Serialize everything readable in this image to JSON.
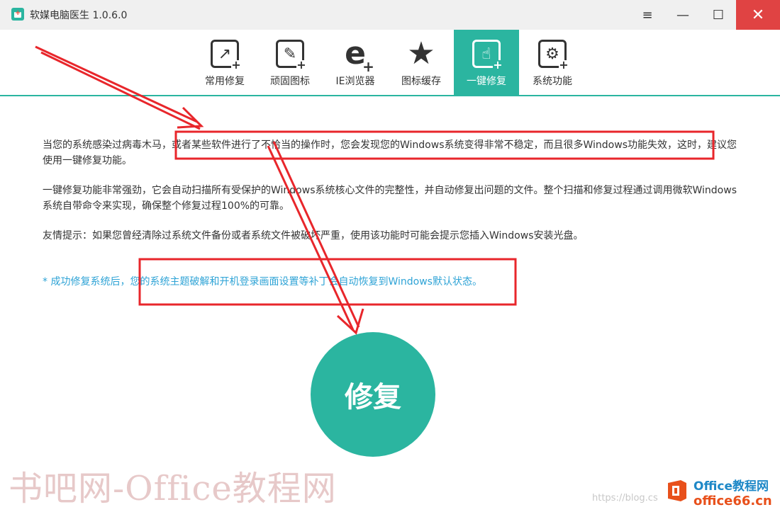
{
  "window": {
    "title": "软媒电脑医生 1.0.6.0",
    "menu_icon": "≡",
    "minimize_icon": "—",
    "maximize_icon": "☐",
    "close_icon": "✕"
  },
  "toolbar": {
    "tabs": [
      {
        "label": "常用修复",
        "icon": "repair-arrow-icon",
        "active": false
      },
      {
        "label": "顽固图标",
        "icon": "wrench-icon",
        "active": false
      },
      {
        "label": "IE浏览器",
        "icon": "ie-icon",
        "active": false
      },
      {
        "label": "图标缓存",
        "icon": "star-wrench-icon",
        "active": false
      },
      {
        "label": "一键修复",
        "icon": "hand-click-icon",
        "active": true
      },
      {
        "label": "系统功能",
        "icon": "gears-icon",
        "active": false
      }
    ]
  },
  "content": {
    "p1": "当您的系统感染过病毒木马，或者某些软件进行了不恰当的操作时，您会发现您的Windows系统变得非常不稳定，而且很多Windows功能失效，这时，建议您使用一键修复功能。",
    "p2": "一键修复功能非常强劲，它会自动扫描所有受保护的Windows系统核心文件的完整性，并自动修复出问题的文件。整个扫描和修复过程通过调用微软Windows系统自带命令来实现，确保整个修复过程100%的可靠。",
    "p3": "友情提示：如果您曾经清除过系统文件备份或者系统文件被破坏严重，使用该功能时可能会提示您插入Windows安装光盘。",
    "note": "* 成功修复系统后，您的系统主题破解和开机登录画面设置等补丁会自动恢复到Windows默认状态。",
    "repair_button": "修复"
  },
  "watermark": {
    "left_text": "书吧网-Office教程网",
    "url": "https://blog.cs",
    "brand": "Office教程网",
    "domain": "office66.cn"
  },
  "colors": {
    "accent": "#2bb5a0",
    "close_red": "#e04343",
    "note_blue": "#2ea3d6",
    "annotation_red": "#e8262b"
  }
}
